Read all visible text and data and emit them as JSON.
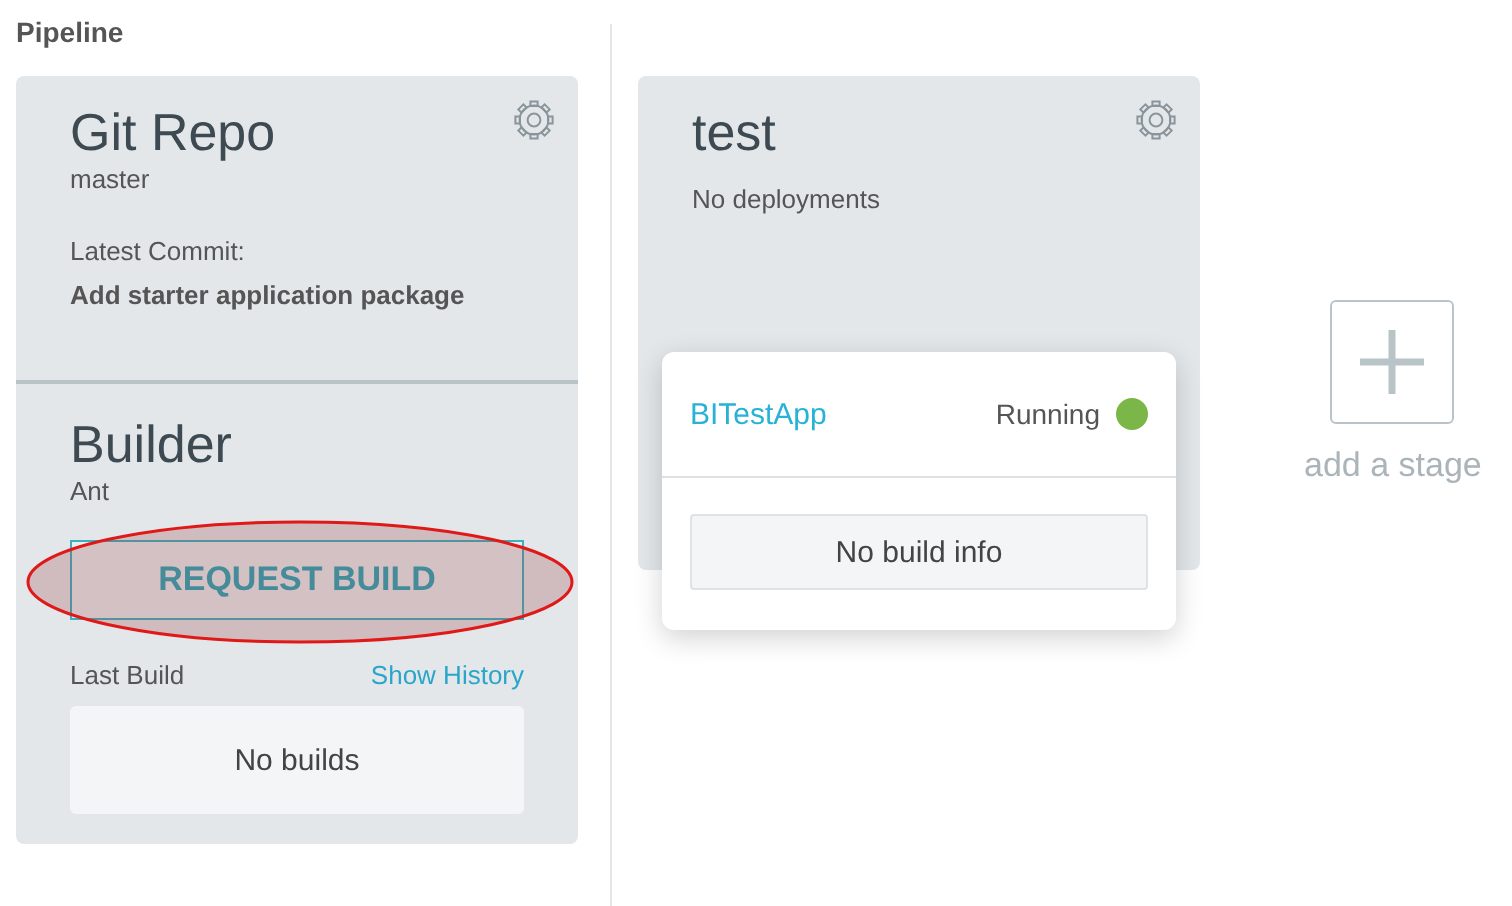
{
  "title": "Pipeline",
  "source": {
    "title": "Git Repo",
    "branch": "master",
    "commit_label": "Latest Commit:",
    "commit_message": "Add starter application package"
  },
  "builder": {
    "title": "Builder",
    "type": "Ant",
    "request_button": {
      "label": "REQUEST BUILD",
      "highlighted": true
    },
    "last_build_label": "Last Build",
    "history_link": "Show History",
    "builds_placeholder": "No builds"
  },
  "stages": [
    {
      "title": "test",
      "deployments_text": "No deployments",
      "apps": [
        {
          "name": "BITestApp",
          "status": "Running",
          "color": "#7ab648",
          "build_info": "No build info"
        }
      ]
    }
  ],
  "add_stage": {
    "label": "add a stage"
  }
}
